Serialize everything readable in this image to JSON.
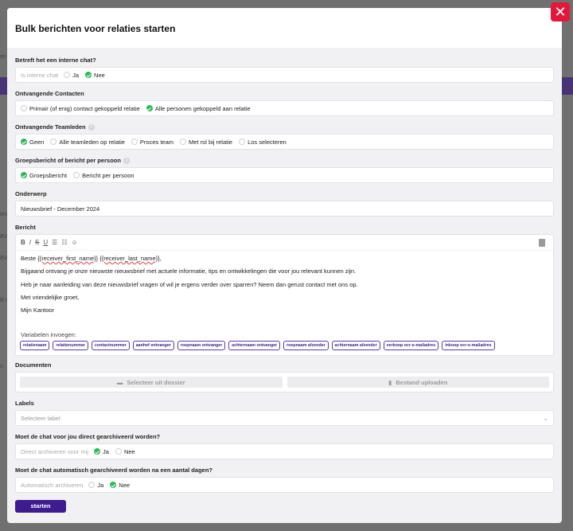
{
  "background": {
    "side_letters": [
      "en",
      "ies",
      "BV",
      "BV",
      "B.V",
      "v."
    ]
  },
  "modal": {
    "title": "Bulk berichten voor relaties starten",
    "close_label": "✕"
  },
  "internal_chat": {
    "label": "Betreft het een interne chat?",
    "prefix": "Is interne chat",
    "options": [
      "Ja",
      "Nee"
    ],
    "selected": "Nee"
  },
  "recipients": {
    "label": "Ontvangende Contacten",
    "options": [
      "Primair (of enig) contact gekoppeld relatie",
      "Alle personen gekoppeld aan relatie"
    ],
    "selected": "Alle personen gekoppeld aan relatie"
  },
  "team_members": {
    "label": "Ontvangende Teamleden",
    "options": [
      "Geen",
      "Alle teamleden op relatie",
      "Proces team",
      "Met rol bij relatie",
      "Los selecteren"
    ],
    "selected": "Geen"
  },
  "group_message": {
    "label": "Groepsbericht of bericht per persoon",
    "options": [
      "Groepsbericht",
      "Bericht per persoon"
    ],
    "selected": "Groepsbericht"
  },
  "subject": {
    "label": "Onderwerp",
    "value": "Nieuwsbrief - December 2024"
  },
  "message": {
    "label": "Bericht",
    "toolbar": [
      "B",
      "I",
      "S",
      "U",
      "☰",
      "☷",
      "☺"
    ],
    "greeting_prefix": "Beste ",
    "greeting_var1": "{{receiver_first_name}}",
    "greeting_var2": "{{receiver_last_name}}",
    "greeting_suffix": ",",
    "line1": "Bijgaand ontvang je onze nieuwste nieuwsbrief met actuele informatie, tips en ontwikkelingen die voor jou relevant kunnen zijn.",
    "line2": "Heb je naar aanleiding van deze nieuwsbrief vragen of wil je ergens verder over sparren? Neem dan gerust contact met ons op.",
    "line3": "Met vriendelijke groet,",
    "line4": "Mijn Kantoor",
    "variables_label": "Variabelen invoegen:",
    "variables": [
      "relatienaam",
      "relatienummer",
      "contactnummer",
      "aanhef ontvanger",
      "roepnaam ontvanger",
      "achternaam ontvanger",
      "roepnaam afzender",
      "achternaam afzender",
      "verkoop ocr-e-mailadres",
      "inkoop ocr-e-mailadres"
    ]
  },
  "documents": {
    "label": "Documenten",
    "select_button": "Selecteer uit dossier",
    "upload_button": "Bestand uploaden"
  },
  "labels": {
    "label": "Labels",
    "placeholder": "Selecteer label"
  },
  "archive_direct": {
    "label": "Moet de chat voor jou direct gearchiveerd worden?",
    "prefix": "Direct archiveren voor mij",
    "options": [
      "Ja",
      "Nee"
    ],
    "selected": "Ja"
  },
  "archive_auto": {
    "label": "Moet de chat automatisch gearchiveerd worden na een aantal dagen?",
    "prefix": "Automatisch archiveren",
    "options": [
      "Ja",
      "Nee"
    ],
    "selected": "Nee"
  },
  "submit_label": "starten",
  "colors": {
    "accent": "#3f1c8e",
    "checked": "#2bb85a",
    "close": "#e3173a"
  }
}
